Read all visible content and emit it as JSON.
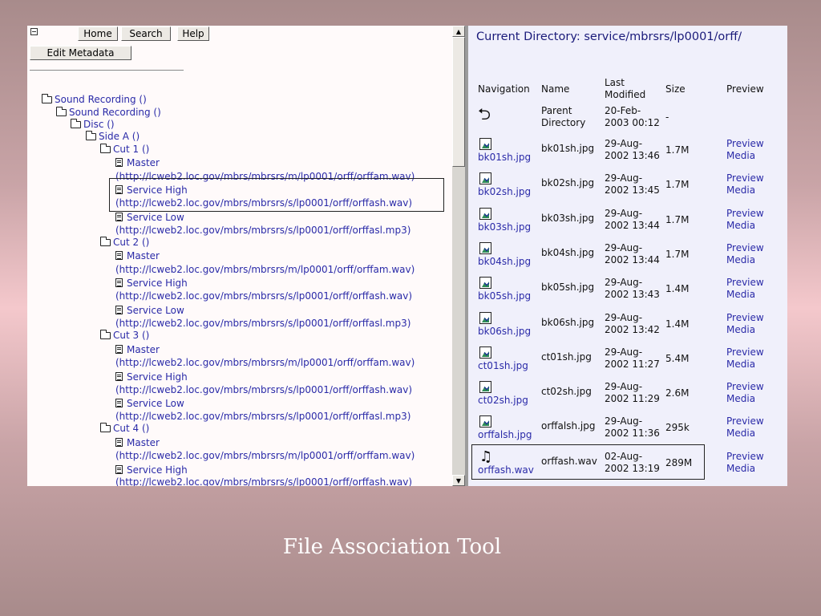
{
  "toolbar": {
    "home": "Home",
    "search": "Search",
    "help": "Help",
    "edit_metadata": "Edit Metadata"
  },
  "tree": {
    "root": "Sound Recording ()",
    "child": "Sound Recording ()",
    "disc": "Disc ()",
    "side": "Side A ()",
    "cuts": [
      {
        "label": "Cut 1 ()",
        "files": [
          {
            "label": "Master",
            "url": "(http://lcweb2.loc.gov/mbrs/mbrsrs/m/lp0001/orff/orffam.wav)"
          },
          {
            "label": "Service High",
            "url": "(http://lcweb2.loc.gov/mbrs/mbrsrs/s/lp0001/orff/orffash.wav)"
          },
          {
            "label": "Service Low",
            "url": "(http://lcweb2.loc.gov/mbrs/mbrsrs/s/lp0001/orff/orffasl.mp3)"
          }
        ]
      },
      {
        "label": "Cut 2 ()",
        "files": [
          {
            "label": "Master",
            "url": "(http://lcweb2.loc.gov/mbrs/mbrsrs/m/lp0001/orff/orffam.wav)"
          },
          {
            "label": "Service High",
            "url": "(http://lcweb2.loc.gov/mbrs/mbrsrs/s/lp0001/orff/orffash.wav)"
          },
          {
            "label": "Service Low",
            "url": "(http://lcweb2.loc.gov/mbrs/mbrsrs/s/lp0001/orff/orffasl.mp3)"
          }
        ]
      },
      {
        "label": "Cut 3 ()",
        "files": [
          {
            "label": "Master",
            "url": "(http://lcweb2.loc.gov/mbrs/mbrsrs/m/lp0001/orff/orffam.wav)"
          },
          {
            "label": "Service High",
            "url": "(http://lcweb2.loc.gov/mbrs/mbrsrs/s/lp0001/orff/orffash.wav)"
          },
          {
            "label": "Service Low",
            "url": "(http://lcweb2.loc.gov/mbrs/mbrsrs/s/lp0001/orff/orffasl.mp3)"
          }
        ]
      },
      {
        "label": "Cut 4 ()",
        "files": [
          {
            "label": "Master",
            "url": "(http://lcweb2.loc.gov/mbrs/mbrsrs/m/lp0001/orff/orffam.wav)"
          },
          {
            "label": "Service High",
            "url": "(http://lcweb2.loc.gov/mbrs/mbrsrs/s/lp0001/orff/orffash.wav)"
          }
        ]
      }
    ]
  },
  "directory": {
    "current": "Current Directory: service/mbrsrs/lp0001/orff/",
    "headers": {
      "navigation": "Navigation",
      "name": "Name",
      "modified_1": "Last",
      "modified_2": "Modified",
      "size": "Size",
      "preview": "Preview"
    },
    "parent": {
      "name_1": "Parent",
      "name_2": "Directory",
      "date": "20-Feb-",
      "time": "2003 00:12",
      "size": "-"
    },
    "rows": [
      {
        "link": "bk01sh.jpg",
        "name": "bk01sh.jpg",
        "date": "29-Aug-",
        "time": "2002 13:46",
        "size": "1.7M",
        "preview_1": "Preview",
        "preview_2": "Media",
        "icon": "image"
      },
      {
        "link": "bk02sh.jpg",
        "name": "bk02sh.jpg",
        "date": "29-Aug-",
        "time": "2002 13:45",
        "size": "1.7M",
        "preview_1": "Preview",
        "preview_2": "Media",
        "icon": "image"
      },
      {
        "link": "bk03sh.jpg",
        "name": "bk03sh.jpg",
        "date": "29-Aug-",
        "time": "2002 13:44",
        "size": "1.7M",
        "preview_1": "Preview",
        "preview_2": "Media",
        "icon": "image"
      },
      {
        "link": "bk04sh.jpg",
        "name": "bk04sh.jpg",
        "date": "29-Aug-",
        "time": "2002 13:44",
        "size": "1.7M",
        "preview_1": "Preview",
        "preview_2": "Media",
        "icon": "image"
      },
      {
        "link": "bk05sh.jpg",
        "name": "bk05sh.jpg",
        "date": "29-Aug-",
        "time": "2002 13:43",
        "size": "1.4M",
        "preview_1": "Preview",
        "preview_2": "Media",
        "icon": "image"
      },
      {
        "link": "bk06sh.jpg",
        "name": "bk06sh.jpg",
        "date": "29-Aug-",
        "time": "2002 13:42",
        "size": "1.4M",
        "preview_1": "Preview",
        "preview_2": "Media",
        "icon": "image"
      },
      {
        "link": "ct01sh.jpg",
        "name": "ct01sh.jpg",
        "date": "29-Aug-",
        "time": "2002 11:27",
        "size": "5.4M",
        "preview_1": "Preview",
        "preview_2": "Media",
        "icon": "image"
      },
      {
        "link": "ct02sh.jpg",
        "name": "ct02sh.jpg",
        "date": "29-Aug-",
        "time": "2002 11:29",
        "size": "2.6M",
        "preview_1": "Preview",
        "preview_2": "Media",
        "icon": "image"
      },
      {
        "link": "orffalsh.jpg",
        "name": "orffalsh.jpg",
        "date": "29-Aug-",
        "time": "2002 11:36",
        "size": "295k",
        "preview_1": "Preview",
        "preview_2": "Media",
        "icon": "image"
      },
      {
        "link": "orffash.wav",
        "name": "orffash.wav",
        "date": "02-Aug-",
        "time": "2002 13:19",
        "size": "289M",
        "preview_1": "Preview",
        "preview_2": "Media",
        "icon": "audio"
      }
    ]
  },
  "caption": "File Association Tool"
}
